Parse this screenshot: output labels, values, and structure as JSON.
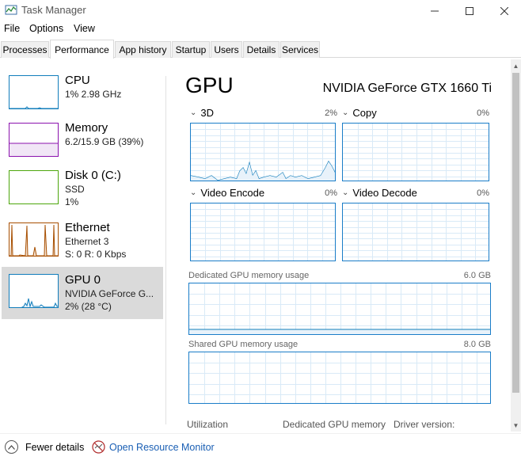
{
  "window": {
    "title": "Task Manager",
    "icon": "task-manager-icon"
  },
  "menu": [
    "File",
    "Options",
    "View"
  ],
  "tabs": [
    {
      "label": "Processes",
      "active": false
    },
    {
      "label": "Performance",
      "active": true
    },
    {
      "label": "App history",
      "active": false
    },
    {
      "label": "Startup",
      "active": false
    },
    {
      "label": "Users",
      "active": false
    },
    {
      "label": "Details",
      "active": false
    },
    {
      "label": "Services",
      "active": false
    }
  ],
  "sidebar": {
    "items": [
      {
        "title": "CPU",
        "line1": "1%  2.98 GHz",
        "line2": "",
        "color": "#117dbb"
      },
      {
        "title": "Memory",
        "line1": "6.2/15.9 GB (39%)",
        "line2": "",
        "color": "#8b12ae"
      },
      {
        "title": "Disk 0 (C:)",
        "line1": "SSD",
        "line2": "1%",
        "color": "#4da60c"
      },
      {
        "title": "Ethernet",
        "line1": "Ethernet 3",
        "line2": "S: 0  R: 0 Kbps",
        "color": "#a74f01"
      },
      {
        "title": "GPU 0",
        "line1": "NVIDIA GeForce G...",
        "line2": "2%  (28 °C)",
        "color": "#117dbb",
        "selected": true
      }
    ]
  },
  "main": {
    "title": "GPU",
    "device_name": "NVIDIA GeForce GTX 1660 Ti",
    "engines": [
      {
        "label": "3D",
        "percent": "2%"
      },
      {
        "label": "Copy",
        "percent": "0%"
      },
      {
        "label": "Video Encode",
        "percent": "0%"
      },
      {
        "label": "Video Decode",
        "percent": "0%"
      }
    ],
    "dedicated_memory": {
      "label": "Dedicated GPU memory usage",
      "value": "6.0 GB"
    },
    "shared_memory": {
      "label": "Shared GPU memory usage",
      "value": "8.0 GB"
    },
    "stats": {
      "utilization": "Utilization",
      "dedicated": "Dedicated GPU memory",
      "driver": "Driver version:"
    }
  },
  "bottom": {
    "fewer_details": "Fewer details",
    "open_monitor": "Open Resource Monitor"
  },
  "colors": {
    "accent_blue": "#117dbb",
    "graph_border": "#1a7dc8",
    "grid": "#d9eaf7",
    "selected_bg": "#dadada"
  }
}
